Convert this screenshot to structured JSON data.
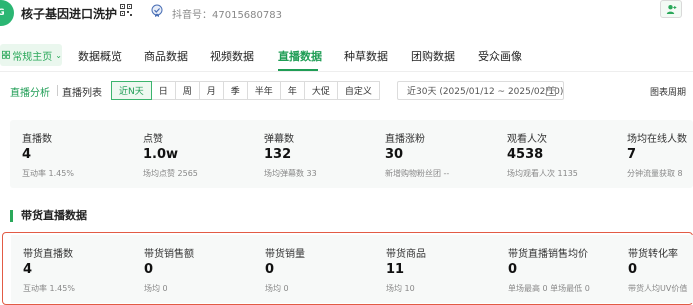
{
  "header": {
    "logo_text": "G",
    "shop_name": "核子基因进口洗护",
    "douyin_id": "抖音号：47015680783"
  },
  "nav": {
    "select_label": "常规主页",
    "tabs": [
      {
        "label": "数据概览"
      },
      {
        "label": "商品数据"
      },
      {
        "label": "视频数据"
      },
      {
        "label": "直播数据"
      },
      {
        "label": "种草数据"
      },
      {
        "label": "团购数据"
      },
      {
        "label": "受众画像"
      }
    ],
    "active_tab": "直播数据"
  },
  "filter": {
    "title": "直播分析",
    "list_link": "直播列表",
    "periods": [
      "近N天",
      "日",
      "周",
      "月",
      "季",
      "半年",
      "年",
      "大促",
      "自定义"
    ],
    "active_period": "近N天",
    "date_range": "近30天 (2025/01/12 ~ 2025/02/10)",
    "chart_link": "图表周期"
  },
  "stats": [
    {
      "label": "直播数",
      "value": "4",
      "sub": "互动率 1.45%"
    },
    {
      "label": "点赞",
      "value": "1.0w",
      "sub": "场均点赞 2565"
    },
    {
      "label": "弹幕数",
      "value": "132",
      "sub": "场均弹幕数 33"
    },
    {
      "label": "直播涨粉",
      "value": "30",
      "sub": "新增购物粉丝团 --"
    },
    {
      "label": "观看人次",
      "value": "4538",
      "sub": "场均观看人次 1135"
    },
    {
      "label": "场均在线人数",
      "value": "7",
      "sub": "分钟流量获取 8"
    }
  ],
  "section": {
    "title": "带货直播数据"
  },
  "sales_stats": [
    {
      "label": "带货直播数",
      "value": "4",
      "sub": "互动率 1.45%"
    },
    {
      "label": "带货销售额",
      "value": "0",
      "sub": "场均 0"
    },
    {
      "label": "带货销量",
      "value": "0",
      "sub": "场均 0"
    },
    {
      "label": "带货商品",
      "value": "11",
      "sub": "场均 10"
    },
    {
      "label": "带货直播销售均价",
      "value": "0",
      "sub": "单场最高 0  单场最低 0"
    },
    {
      "label": "带货转化率",
      "value": "0",
      "sub": "带货人均UV价值"
    }
  ],
  "colors": {
    "accent": "#1f9d55",
    "highlight_border": "#e25b45"
  }
}
